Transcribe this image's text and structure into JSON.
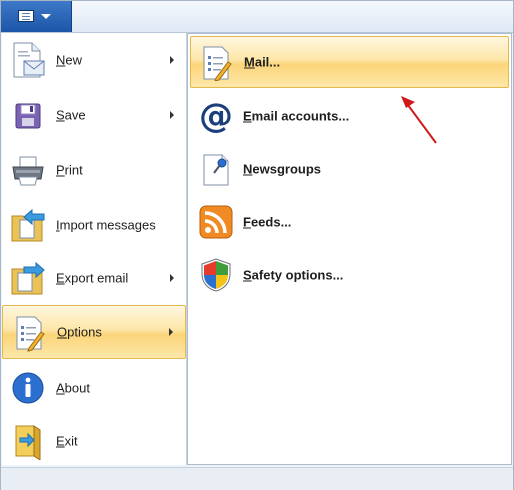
{
  "app_menu": {
    "items": [
      {
        "key": "N",
        "rest": "ew",
        "has_submenu": true,
        "icon": "new-message-icon"
      },
      {
        "key": "S",
        "rest": "ave",
        "has_submenu": true,
        "icon": "floppy-disk-icon"
      },
      {
        "key": "P",
        "rest": "rint",
        "has_submenu": false,
        "icon": "printer-icon"
      },
      {
        "key": "I",
        "rest": "mport messages",
        "has_submenu": false,
        "icon": "import-folder-icon"
      },
      {
        "key": "E",
        "rest": "xport email",
        "has_submenu": true,
        "icon": "export-folder-icon"
      },
      {
        "key": "O",
        "rest": "ptions",
        "has_submenu": true,
        "selected": true,
        "icon": "options-checklist-icon"
      },
      {
        "key": "A",
        "rest": "bout",
        "has_submenu": false,
        "icon": "info-icon"
      },
      {
        "key": "E",
        "rest": "xit",
        "has_submenu": false,
        "icon": "exit-door-icon"
      }
    ]
  },
  "options_submenu": {
    "items": [
      {
        "key": "M",
        "rest": "ail...",
        "selected": true,
        "icon": "mail-options-icon"
      },
      {
        "key": "E",
        "rest": "mail accounts...",
        "icon": "at-sign-icon"
      },
      {
        "key": "N",
        "rest": "ewsgroups",
        "icon": "newsgroups-pin-icon"
      },
      {
        "key": "F",
        "rest": "eeds...",
        "icon": "rss-feed-icon"
      },
      {
        "key": "S",
        "rest": "afety options...",
        "icon": "safety-shield-icon"
      }
    ]
  },
  "colors": {
    "highlight_top": "#fff7e0",
    "highlight_mid": "#fbd57a",
    "highlight_border": "#e2b94a",
    "app_button": "#1b56a8",
    "annotation_arrow": "#d0191b"
  }
}
